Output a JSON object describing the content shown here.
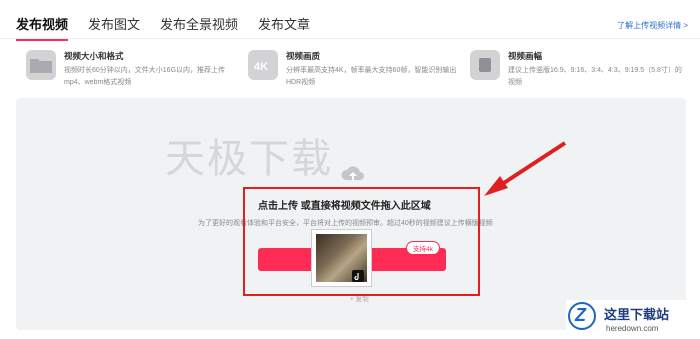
{
  "tabs": [
    "发布视频",
    "发布图文",
    "发布全景视频",
    "发布文章"
  ],
  "help_link": "了解上传视频详情 >",
  "specs": [
    {
      "icon": "folder-icon",
      "title": "视频大小和格式",
      "desc": "视频时长60分钟以内，文件大小16G以内，推荐上传mp4、webm格式视频"
    },
    {
      "icon": "4k-icon",
      "title": "视频画质",
      "desc": "分辨率最高支持4K，帧率最大支持60帧，智能识别输出HDR视频"
    },
    {
      "icon": "aspect-ratio-icon",
      "title": "视频画幅",
      "desc": "建议上传竖版16:9、9:16、3:4、4:3、9:19.5（5.8寸）的视频"
    }
  ],
  "upload": {
    "watermark": "天极下载",
    "title": "点击上传 或直接将视频文件拖入此区域",
    "desc": "为了更好的观看体验和平台安全，平台将对上传的视频预审。超过40秒的视频建议上传横版视频",
    "button": "上传视频",
    "badge": "支持4k",
    "below": "+ 复制"
  },
  "site": {
    "name": "这里下载站",
    "url": "heredown.com"
  }
}
